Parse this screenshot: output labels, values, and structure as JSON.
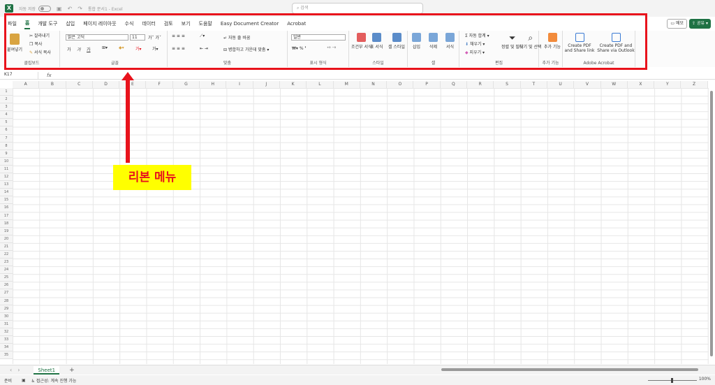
{
  "title_bar": {
    "autosave_label": "자동 저장",
    "document_title": "통합 문서1 - Excel",
    "search_placeholder": "검색"
  },
  "menu_tabs": [
    "파일",
    "홈",
    "개발 도구",
    "삽입",
    "페이지 레이아웃",
    "수식",
    "데이터",
    "검토",
    "보기",
    "도움말",
    "Easy Document Creator",
    "Acrobat"
  ],
  "memo_label": "메모",
  "share_label": "공유",
  "ribbon": {
    "clipboard": {
      "paste": "붙여넣기",
      "cut": "잘라내기",
      "copy": "복사",
      "format_painter": "서식 복사",
      "label": "클립보드"
    },
    "font": {
      "name": "맑은 고딕",
      "size": "11",
      "label": "글꼴"
    },
    "alignment": {
      "wrap": "자동 줄 바꿈",
      "merge": "병합하고 가운데 맞춤",
      "label": "맞춤"
    },
    "number": {
      "format": "일반",
      "label": "표시 형식"
    },
    "styles": {
      "conditional": "조건부 서식",
      "table": "표 서식",
      "cell": "셀 스타일",
      "label": "스타일"
    },
    "cells": {
      "insert": "삽입",
      "delete": "삭제",
      "format": "서식",
      "label": "셀"
    },
    "editing": {
      "autosum": "자동 합계",
      "fill": "채우기",
      "clear": "지우기",
      "sort": "정렬 및 필터",
      "find": "찾기 및 선택",
      "label": "편집"
    },
    "addins": {
      "button": "추가 기능",
      "label": "추가 기능"
    },
    "adobe": {
      "create_share": "Create PDF and Share link",
      "create_outlook": "Create PDF and Share via Outlook",
      "label": "Adobe Acrobat"
    }
  },
  "name_box": "K17",
  "fx_label": "fx",
  "columns": [
    "A",
    "B",
    "C",
    "D",
    "E",
    "F",
    "G",
    "H",
    "I",
    "J",
    "K",
    "L",
    "M",
    "N",
    "O",
    "P",
    "Q",
    "R",
    "S",
    "T",
    "U",
    "V",
    "W",
    "X",
    "Y",
    "Z"
  ],
  "rows": [
    "1",
    "2",
    "3",
    "4",
    "5",
    "6",
    "7",
    "8",
    "9",
    "10",
    "11",
    "12",
    "13",
    "14",
    "15",
    "16",
    "17",
    "18",
    "19",
    "20",
    "21",
    "22",
    "23",
    "24",
    "25",
    "26",
    "27",
    "28",
    "29",
    "30",
    "31",
    "32",
    "33",
    "34",
    "35"
  ],
  "annotation": {
    "callout_text": "리본 메뉴"
  },
  "sheet_tab": "Sheet1",
  "status": {
    "ready": "준비",
    "accessibility": "접근성: 계속 진행 가능",
    "zoom": "100%"
  },
  "colors": {
    "excel_green": "#1f7244",
    "annotation_red": "#e8131c",
    "callout_yellow": "#ffff00"
  }
}
